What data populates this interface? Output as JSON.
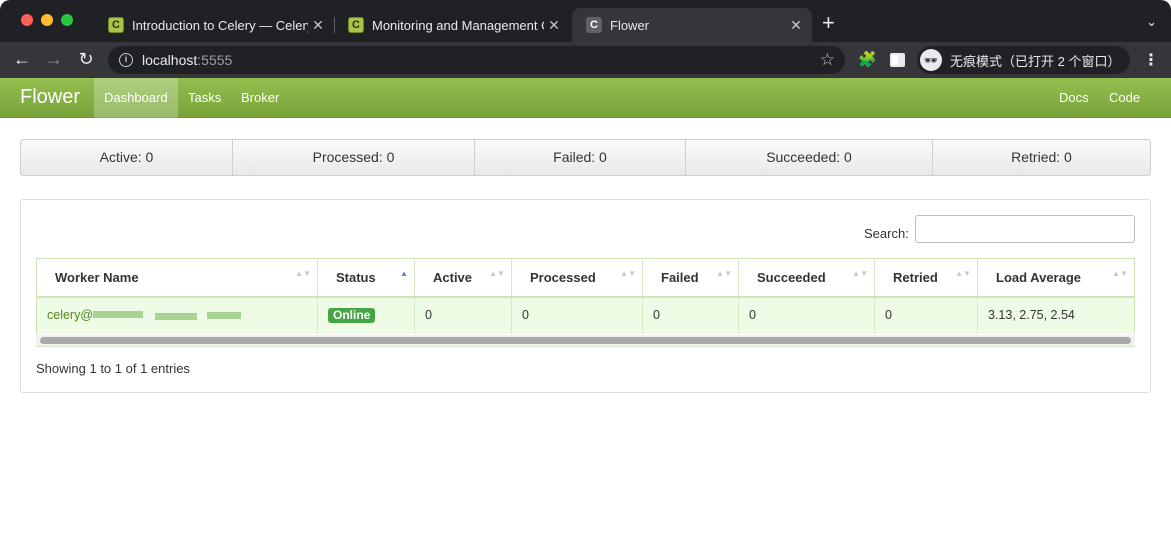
{
  "browser": {
    "tabs": [
      {
        "title": "Introduction to Celery — Celery",
        "favicon": "celery-favicon",
        "active": false
      },
      {
        "title": "Monitoring and Management Gu",
        "favicon": "celery-favicon",
        "active": false
      },
      {
        "title": "Flower",
        "favicon": "flower-favicon",
        "active": true
      }
    ],
    "favicon_letter": "C",
    "close_glyph": "✕",
    "new_tab_glyph": "+",
    "tab_search_glyph": "⌄",
    "nav": {
      "back": "←",
      "forward": "→",
      "reload": "↻"
    },
    "url_host": "localhost",
    "url_port": ":5555",
    "star_glyph": "☆",
    "puzzle_glyph": "🧩",
    "incognito_label": "无痕模式（已打开 2 个窗口）",
    "incognito_glyph": "🕶",
    "menu_glyph": "⋮"
  },
  "flower": {
    "brand": "Flower",
    "nav": {
      "dashboard": "Dashboard",
      "tasks": "Tasks",
      "broker": "Broker",
      "docs": "Docs",
      "code": "Code"
    },
    "stats": {
      "active": "Active: 0",
      "processed": "Processed: 0",
      "failed": "Failed: 0",
      "succeeded": "Succeeded: 0",
      "retried": "Retried: 0"
    },
    "search_label": "Search:",
    "search_value": "",
    "table": {
      "headers": {
        "worker_name": "Worker Name",
        "status": "Status",
        "active": "Active",
        "processed": "Processed",
        "failed": "Failed",
        "succeeded": "Succeeded",
        "retried": "Retried",
        "load_average": "Load Average"
      },
      "sort_icons": {
        "both": "▲▼",
        "asc": "▲"
      },
      "rows": [
        {
          "worker_name": "celery@",
          "status": "Online",
          "active": "0",
          "processed": "0",
          "failed": "0",
          "succeeded": "0",
          "retried": "0",
          "load_average": "3.13, 2.75, 2.54"
        }
      ]
    },
    "info": "Showing 1 to 1 of 1 entries",
    "colors": {
      "navbar": "#86b346",
      "online_badge": "#46a646",
      "row_bg": "#eefce6"
    }
  }
}
